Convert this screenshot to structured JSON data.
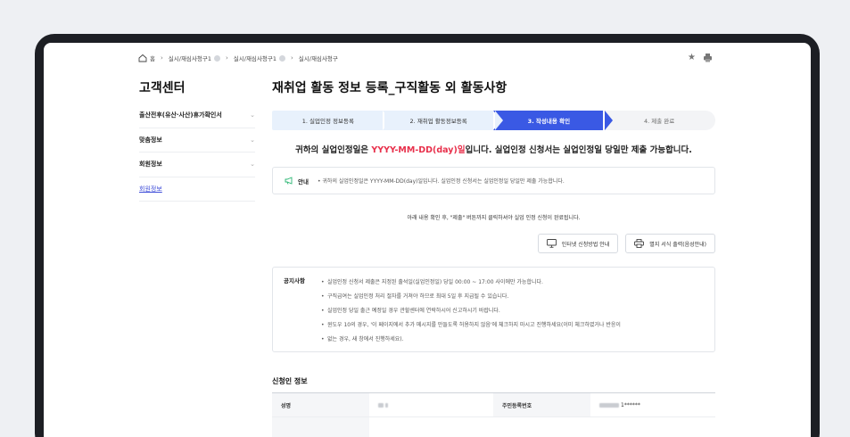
{
  "breadcrumb": {
    "home": "홈",
    "items": [
      "실시/재심사청구1",
      "실시/재심사청구1",
      "실시/재심사청구"
    ]
  },
  "sidebar": {
    "title": "고객센터",
    "items": [
      {
        "label": "출산전후(유산·사산)휴가확인서",
        "type": "expand"
      },
      {
        "label": "맞춤정보",
        "type": "expand"
      },
      {
        "label": "회원정보",
        "type": "expand"
      },
      {
        "label": "회원정보",
        "type": "link"
      }
    ]
  },
  "main": {
    "title": "재취업 활동 정보 등록_구직활동 외 활동사항",
    "steps": [
      {
        "label": "1. 실업인정 정보등록",
        "state": "done"
      },
      {
        "label": "2. 재취업 활동정보등록",
        "state": "done"
      },
      {
        "label": "3. 작성내용 확인",
        "state": "active"
      },
      {
        "label": "4. 제출 완료",
        "state": "pending"
      }
    ],
    "headline": {
      "prefix": "귀하의 실업인정일은 ",
      "date": "YYYY-MM-DD(day)일",
      "suffix": "입니다. 실업인정 신청서는 실업인정일 당일만 제출 가능합니다."
    },
    "guide": {
      "label": "안내",
      "text": "• 귀하의 실업인정일은 YYYY-MM-DD(day)일입니다. 실업인정 신청서는 실업인정일 당일만 제출 가능합니다."
    },
    "confirm_text": "아래 내용 확인 후, \"제출\" 버튼까지 클릭하셔야 실업 인정 신청이 완료됩니다.",
    "buttons": {
      "internet_guide": "인터넷 신청방법 안내",
      "print_form": "별지 서식 출력(음성안내)"
    },
    "notice": {
      "label": "공지사항",
      "items": [
        "실업인정 신청서 제출은 지정된 출석일(실업인정일) 당일 00:00 ~ 17:00 사이에만 가능합니다.",
        "구직급여는 실업인정 처리 절차를 거쳐야 하므로 최대 5일 후 지급될 수 있습니다.",
        "실업인정 당일 출근 예정일 경우 관할센터에 연락하시어 신고하시기 바랍니다.",
        "윈도우 10의 경우, '이 페이지에서 추가 메시지를 만들도록 허용하지 않음'에 체크하지 마시고 진행하세요(이미 체크하였거나 반응이",
        "없는 경우, 새 창에서 진행하세요)."
      ]
    },
    "applicant": {
      "section_title": "신청인 정보",
      "name_label": "성명",
      "rrn_label": "주민등록번호",
      "rrn_suffix": "1******"
    }
  },
  "colors": {
    "accent": "#3a59e4",
    "highlight": "#e8304b",
    "step_done": "#e8f1fc"
  }
}
